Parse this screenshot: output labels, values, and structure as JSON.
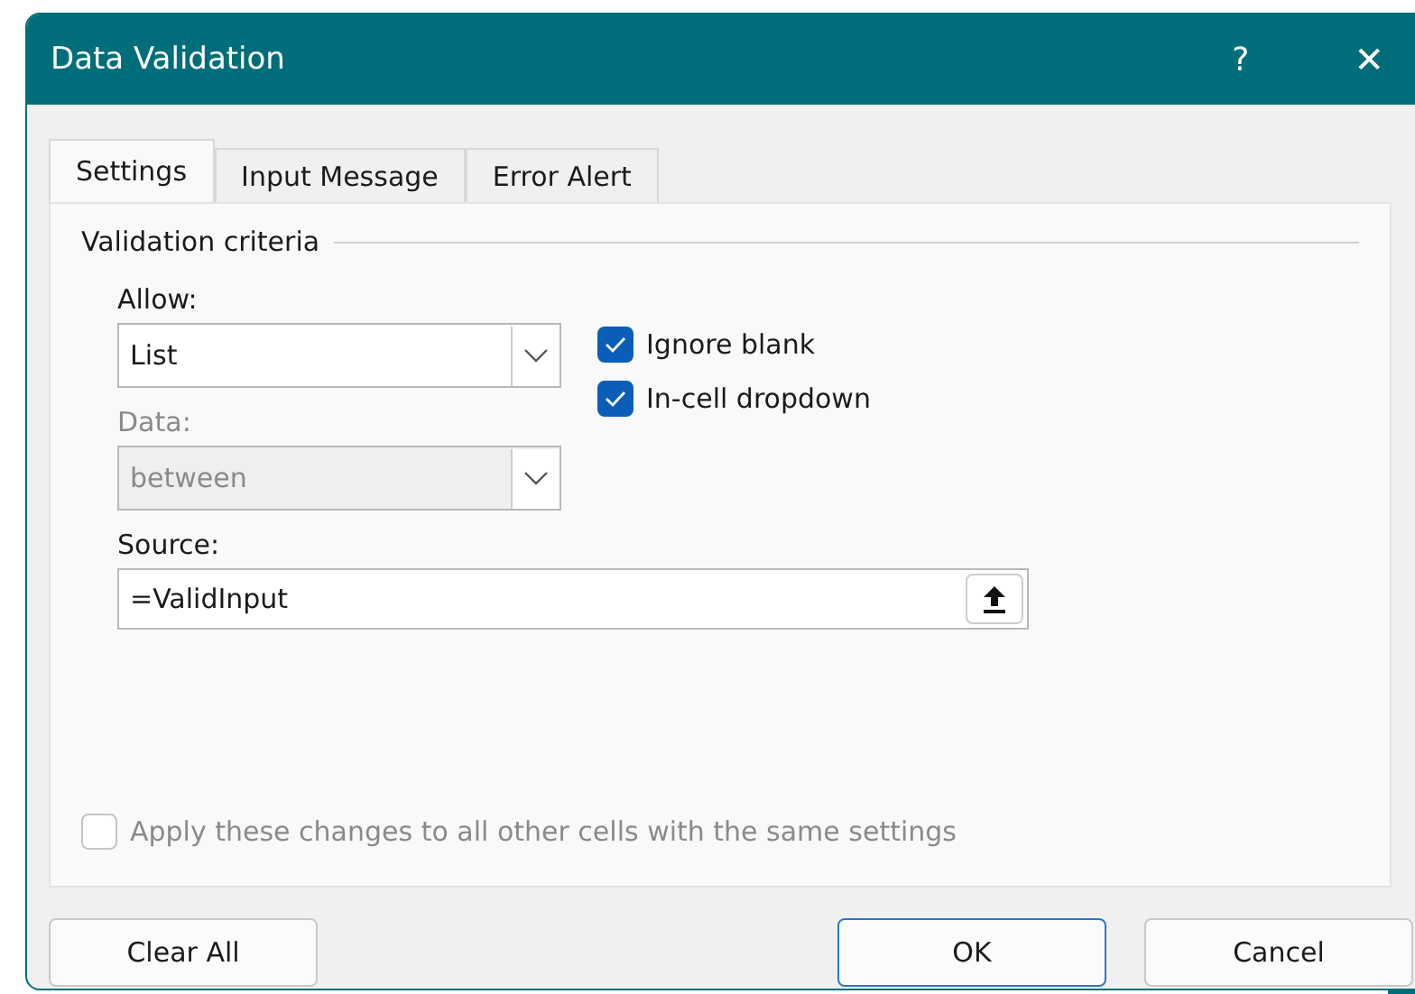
{
  "window": {
    "title": "Data Validation",
    "help": "?",
    "close": "✕"
  },
  "tabs": [
    {
      "label": "Settings",
      "selected": true
    },
    {
      "label": "Input Message",
      "selected": false
    },
    {
      "label": "Error Alert",
      "selected": false
    }
  ],
  "settings": {
    "group_title": "Validation criteria",
    "allow": {
      "label": "Allow:",
      "value": "List",
      "disabled": false
    },
    "data": {
      "label": "Data:",
      "value": "between",
      "disabled": true
    },
    "checkboxes": [
      {
        "label": "Ignore blank",
        "checked": true,
        "disabled": false
      },
      {
        "label": "In-cell dropdown",
        "checked": true,
        "disabled": false
      }
    ],
    "source": {
      "label": "Source:",
      "value": "=ValidInput"
    },
    "apply_all": {
      "label": "Apply these changes to all other cells with the same settings",
      "checked": false,
      "disabled": true
    }
  },
  "buttons": [
    {
      "label": "Clear All",
      "kind": "left",
      "default": false
    },
    {
      "label": "OK",
      "kind": "right",
      "default": true
    },
    {
      "label": "Cancel",
      "kind": "right",
      "default": false
    }
  ]
}
